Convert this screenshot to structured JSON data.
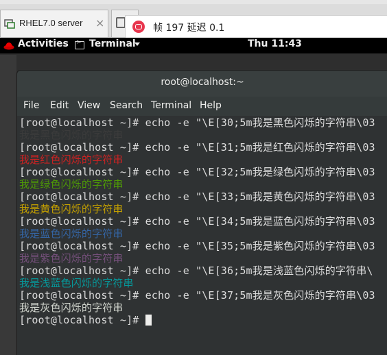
{
  "vm_tabs": {
    "tab1_title": "RHEL7.0 server",
    "tab1_close": "×"
  },
  "fps_overlay": {
    "text": "帧 197 延迟 0.1"
  },
  "gnome": {
    "activities": "Activities",
    "app_name": "Terminal",
    "clock": "Thu 11:43"
  },
  "terminal": {
    "title": "root@localhost:~",
    "menu": [
      "File",
      "Edit",
      "View",
      "Search",
      "Terminal",
      "Help"
    ],
    "lines": [
      {
        "text": "[root@localhost ~]# echo -e \"\\E[30;5m我是黑色闪烁的字符串\\03",
        "color": "#dcdcdc"
      },
      {
        "text": "我是黑色闪烁的字符串",
        "color": "#3b3b3b"
      },
      {
        "text": "[root@localhost ~]# echo -e \"\\E[31;5m我是红色闪烁的字符串\\03",
        "color": "#dcdcdc"
      },
      {
        "text": "我是红色闪烁的字符串",
        "color": "#cc2222"
      },
      {
        "text": "[root@localhost ~]# echo -e \"\\E[32;5m我是绿色闪烁的字符串\\03",
        "color": "#dcdcdc"
      },
      {
        "text": "我是绿色闪烁的字符串",
        "color": "#4e9a06"
      },
      {
        "text": "[root@localhost ~]# echo -e \"\\E[33;5m我是黄色闪烁的字符串\\03",
        "color": "#dcdcdc"
      },
      {
        "text": "我是黄色闪烁的字符串",
        "color": "#c4a000"
      },
      {
        "text": "[root@localhost ~]# echo -e \"\\E[34;5m我是蓝色闪烁的字符串\\03",
        "color": "#dcdcdc"
      },
      {
        "text": "我是蓝色闪烁的字符串",
        "color": "#3465a4"
      },
      {
        "text": "[root@localhost ~]# echo -e \"\\E[35;5m我是紫色闪烁的字符串\\03",
        "color": "#dcdcdc"
      },
      {
        "text": "我是紫色闪烁的字符串",
        "color": "#75507b"
      },
      {
        "text": "[root@localhost ~]# echo -e \"\\E[36;5m我是浅蓝色闪烁的字符串\\",
        "color": "#dcdcdc"
      },
      {
        "text": "我是浅蓝色闪烁的字符串",
        "color": "#06989a"
      },
      {
        "text": "[root@localhost ~]# echo -e \"\\E[37;5m我是灰色闪烁的字符串\\03",
        "color": "#dcdcdc"
      },
      {
        "text": "我是灰色闪烁的字符串",
        "color": "#d3d7cf"
      }
    ],
    "prompt": "[root@localhost ~]# "
  }
}
